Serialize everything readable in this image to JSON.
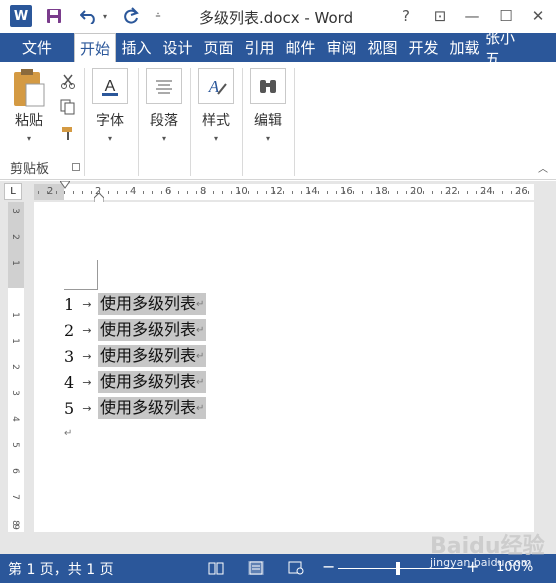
{
  "app": {
    "logo_text": "W",
    "doc_title": "多级列表.docx - Word"
  },
  "window_controls": {
    "help": "?",
    "ribbon_display": "⊡",
    "minimize": "—",
    "maximize": "☐",
    "close": "✕"
  },
  "tabs": [
    {
      "label": "文件"
    },
    {
      "label": "开始"
    },
    {
      "label": "插入"
    },
    {
      "label": "设计"
    },
    {
      "label": "页面"
    },
    {
      "label": "引用"
    },
    {
      "label": "邮件"
    },
    {
      "label": "审阅"
    },
    {
      "label": "视图"
    },
    {
      "label": "开发"
    },
    {
      "label": "加载"
    },
    {
      "label": "张小五"
    }
  ],
  "ribbon": {
    "paste_label": "粘贴",
    "clipboard_group_label": "剪贴板",
    "font_label": "字体",
    "paragraph_label": "段落",
    "styles_label": "样式",
    "editing_label": "编辑"
  },
  "ruler": {
    "h_ticks": [
      "2",
      "2",
      "4",
      "6",
      "8",
      "10",
      "12",
      "14",
      "16",
      "18",
      "20",
      "22",
      "24",
      "26"
    ],
    "v_ticks": [
      "3",
      "2",
      "1",
      "1",
      "1",
      "2",
      "3",
      "4",
      "5",
      "6",
      "7",
      "8",
      "9"
    ],
    "corner_glyph": "L"
  },
  "document": {
    "list_items": [
      {
        "num": "1",
        "text": "使用多级列表"
      },
      {
        "num": "2",
        "text": "使用多级列表"
      },
      {
        "num": "3",
        "text": "使用多级列表"
      },
      {
        "num": "4",
        "text": "使用多级列表"
      },
      {
        "num": "5",
        "text": "使用多级列表"
      }
    ],
    "tab_glyph": "→",
    "para_mark": "↵"
  },
  "status": {
    "pages": "第 1 页，共 1 页",
    "zoom": "100%",
    "zoom_minus": "−",
    "zoom_plus": "+",
    "zoom_fraction": 0.5
  },
  "watermark": {
    "brand": "Baidu经验",
    "url": "jingyan.baidu.com"
  },
  "colors": {
    "accent": "#2b579a",
    "selection": "#c7c7c7"
  }
}
